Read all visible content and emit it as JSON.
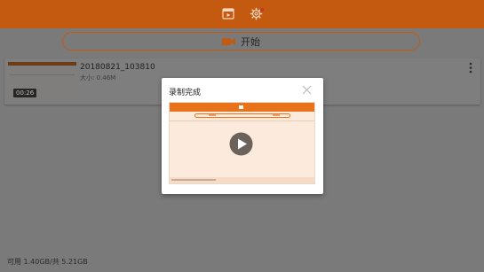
{
  "topbar": {
    "accent_color": "#c45a0f",
    "icons": [
      "video-list-icon",
      "gear-icon"
    ]
  },
  "start_button": {
    "label": "开始",
    "icon": "camera-icon"
  },
  "recording": {
    "filename": "20180821_103810",
    "size": "大小: 0.46M",
    "duration": "00:26"
  },
  "storage": {
    "text": "可用 1.40GB/共 5.21GB"
  },
  "dialog": {
    "title": "录制完成",
    "close_icon": "close-icon",
    "play_icon": "play-icon"
  }
}
